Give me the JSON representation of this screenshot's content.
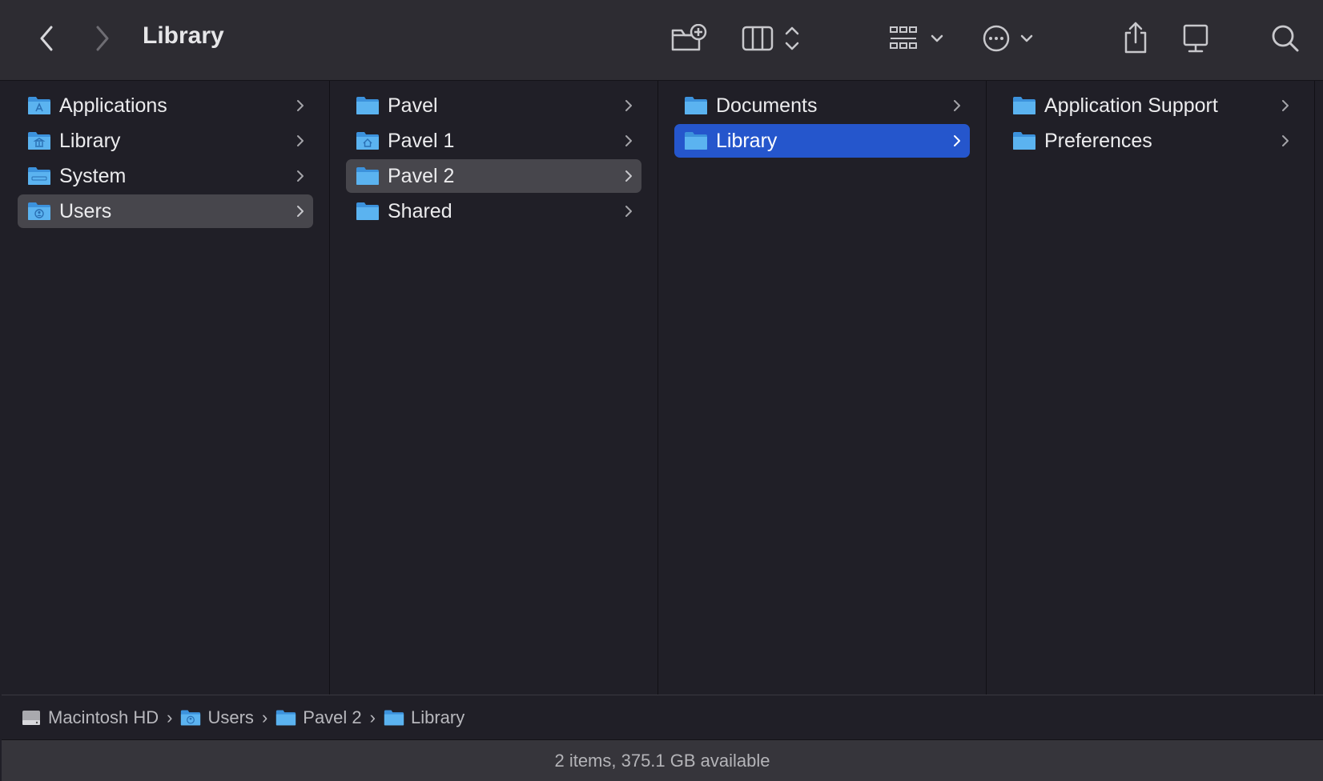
{
  "toolbar": {
    "title": "Library",
    "back_icon": "chevron-left-icon",
    "forward_icon": "chevron-right-icon",
    "new_folder_icon": "new-folder-icon",
    "view_icon": "column-view-icon",
    "group_icon": "group-grid-icon",
    "action_icon": "ellipsis-circle-icon",
    "share_icon": "share-icon",
    "tag_icon": "display-icon",
    "search_icon": "search-icon"
  },
  "columns": [
    {
      "items": [
        {
          "label": "Applications",
          "icon": "applications-folder-icon",
          "selected": ""
        },
        {
          "label": "Library",
          "icon": "library-folder-icon",
          "selected": ""
        },
        {
          "label": "System",
          "icon": "system-folder-icon",
          "selected": ""
        },
        {
          "label": "Users",
          "icon": "users-folder-icon",
          "selected": "gray"
        }
      ]
    },
    {
      "items": [
        {
          "label": "Pavel",
          "icon": "folder-icon",
          "selected": ""
        },
        {
          "label": "Pavel 1",
          "icon": "home-folder-icon",
          "selected": ""
        },
        {
          "label": "Pavel 2",
          "icon": "folder-icon",
          "selected": "gray"
        },
        {
          "label": "Shared",
          "icon": "folder-icon",
          "selected": ""
        }
      ]
    },
    {
      "items": [
        {
          "label": "Documents",
          "icon": "folder-icon",
          "selected": ""
        },
        {
          "label": "Library",
          "icon": "folder-icon",
          "selected": "blue"
        }
      ]
    },
    {
      "items": [
        {
          "label": "Application Support",
          "icon": "folder-icon",
          "selected": ""
        },
        {
          "label": "Preferences",
          "icon": "folder-icon",
          "selected": ""
        }
      ]
    }
  ],
  "pathbar": {
    "crumbs": [
      {
        "label": "Macintosh HD",
        "icon": "hard-drive-icon"
      },
      {
        "label": "Users",
        "icon": "users-folder-icon"
      },
      {
        "label": "Pavel 2",
        "icon": "folder-icon"
      },
      {
        "label": "Library",
        "icon": "folder-icon"
      }
    ],
    "separator": "›"
  },
  "status": {
    "text": "2 items, 375.1 GB available"
  },
  "colors": {
    "accent_blue": "#2556cc",
    "folder_blue": "#5bb3f0",
    "selection_gray": "#47464c"
  }
}
